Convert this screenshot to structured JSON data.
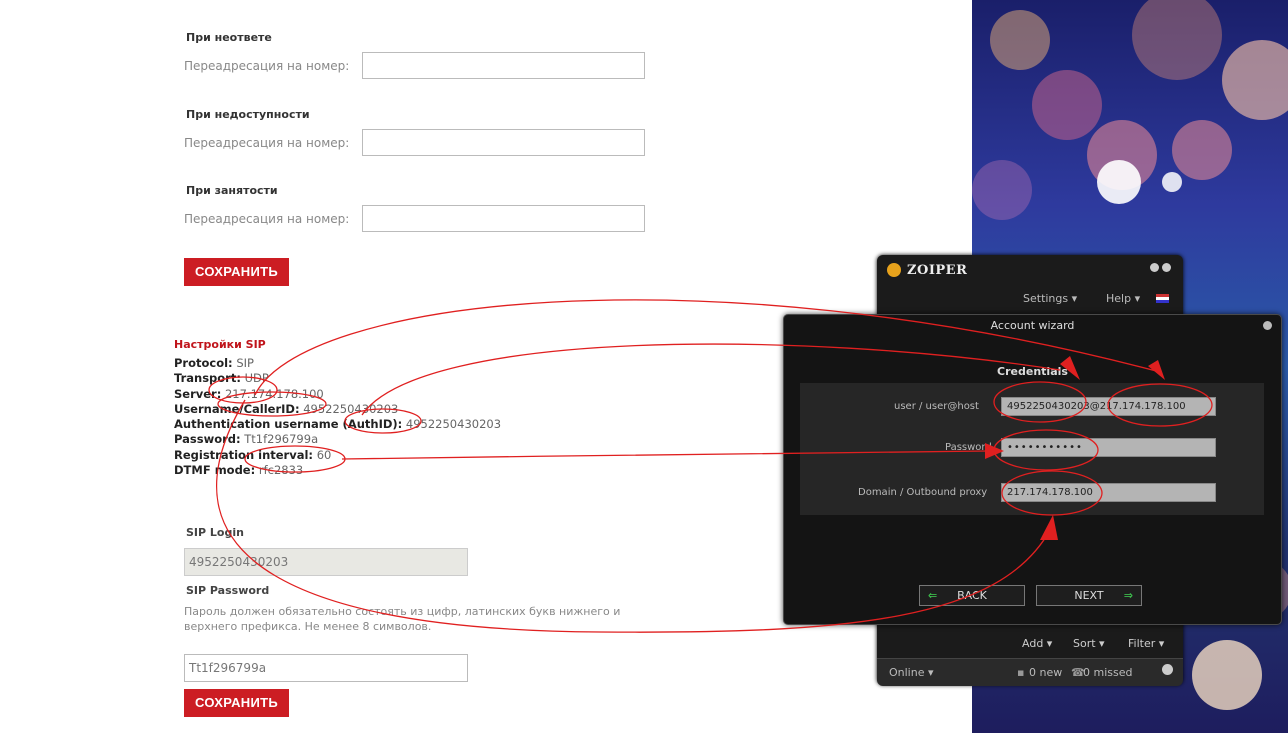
{
  "forwarding": {
    "no_answer_title": "При неответе",
    "unavailable_title": "При недоступности",
    "busy_title": "При занятости",
    "forward_label": "Переадресация на номер:",
    "save_label": "СОХРАНИТЬ"
  },
  "sip": {
    "title": "Настройки SIP",
    "protocol_key": "Protocol:",
    "protocol_val": "SIP",
    "transport_key": "Transport:",
    "transport_val": "UDP",
    "server_key": "Server:",
    "server_val": "217.174.178.100",
    "username_key": "Username/CallerID:",
    "username_val": "4952250430203",
    "authid_key": "Authentication username (AuthID):",
    "authid_val": "4952250430203",
    "password_key": "Password:",
    "password_val": "Tt1f296799a",
    "interval_key": "Registration interval:",
    "interval_val": "60",
    "dtmf_key": "DTMF mode:",
    "dtmf_val": "rfc2833",
    "login_title": "SIP Login",
    "login_value": "4952250430203",
    "password_title": "SIP Password",
    "password_hint": "Пароль должен обязательно состоять из цифр, латинских букв нижнего и верхнего префикса. Не менее 8 символов.",
    "password_value": "Tt1f296799a",
    "save_label": "СОХРАНИТЬ"
  },
  "zoiper": {
    "title": "ZOIPER",
    "settings": "Settings ▾",
    "help": "Help ▾",
    "add": "Add ▾",
    "sort": "Sort ▾",
    "filter": "Filter ▾",
    "online": "Online ▾",
    "new_count": "0 new",
    "missed_count": "0 missed"
  },
  "wizard": {
    "title": "Account wizard",
    "section": "Credentials",
    "user_label": "user / user@host",
    "user_value": "4952250430203@217.174.178.100",
    "password_label": "Password",
    "password_value": "•••••••••••",
    "domain_label": "Domain / Outbound proxy",
    "domain_value": "217.174.178.100",
    "back": "BACK",
    "next": "NEXT"
  },
  "colors": {
    "accent_red": "#cc1d23",
    "annotation_red": "#e02020"
  }
}
